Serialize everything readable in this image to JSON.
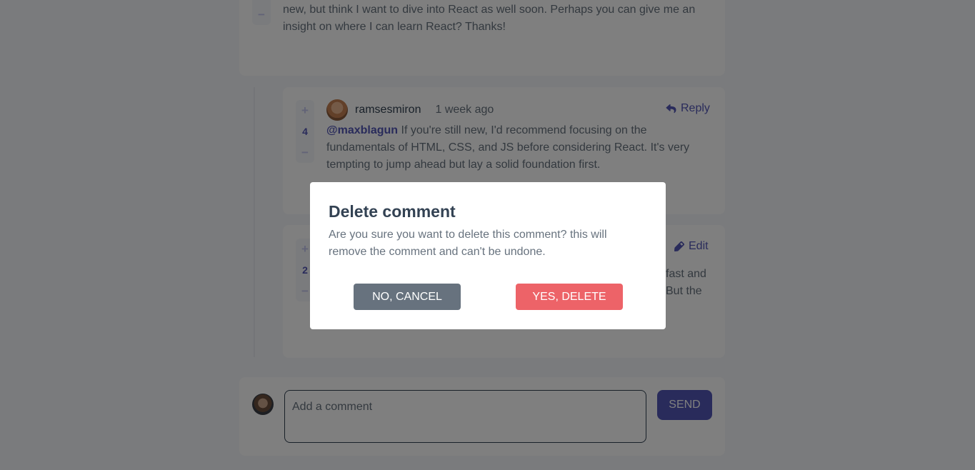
{
  "comment_parent": {
    "text": "new, but think I want to dive into React as well soon. Perhaps you can give me an insight on where I can learn React? Thanks!"
  },
  "reply1": {
    "score": "4",
    "username": "ramsesmiron",
    "time": "1 week ago",
    "mention": "@maxblagun",
    "text": " If you're still new, I'd recommend focusing on the fundamentals of HTML, CSS, and JS before considering React. It's very tempting to jump ahead but lay a solid foundation first.",
    "action": "Reply"
  },
  "reply2": {
    "score": "2",
    "action": "Edit",
    "text_partial_1": "fast and",
    "text_partial_2": "But the"
  },
  "compose": {
    "placeholder": "Add a comment",
    "send": "SEND"
  },
  "modal": {
    "title": "Delete comment",
    "text": "Are you sure you want to delete this comment? this will remove the comment and can't be undone.",
    "cancel": "NO, CANCEL",
    "confirm": "YES, DELETE"
  },
  "colors": {
    "primary": "#5357b6",
    "danger": "#ed6368",
    "neutral": "#67727e"
  }
}
